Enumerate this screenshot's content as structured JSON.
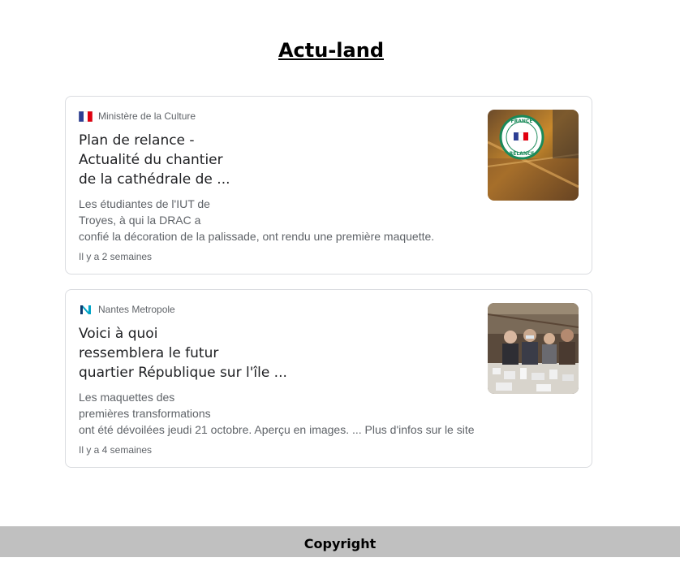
{
  "site": {
    "title": "Actu-land"
  },
  "articles": [
    {
      "source": "Ministère de la Culture",
      "source_logo": "french-flag-icon",
      "headline_lines": [
        "Plan de relance -",
        "Actualité du chantier",
        "de la cathédrale de ..."
      ],
      "snippet_lines": [
        "Les étudiantes de l'IUT de",
        "Troyes, à qui la DRAC a",
        "confié la décoration de la palissade, ont rendu une première maquette."
      ],
      "time": "Il y a 2 semaines",
      "thumbnail": "france-relance-badge-image"
    },
    {
      "source": "Nantes Metropole",
      "source_logo": "nantes-metropole-n-icon",
      "headline_lines": [
        "Voici à quoi",
        "ressemblera le futur",
        "quartier République sur l'île ..."
      ],
      "snippet_lines": [
        "Les maquettes des",
        "premières transformations",
        "ont été dévoilées jeudi 21 octobre. Aperçu en images. ... Plus d'infos sur le site"
      ],
      "time": "Il y a 4 semaines",
      "thumbnail": "architecture-model-people-image"
    }
  ],
  "footer": {
    "text": "Copyright"
  },
  "colors": {
    "footer_bg": "#c0c0c0",
    "border": "#dadce0",
    "muted_text": "#5f6368",
    "nantes_teal": "#00a4c7"
  }
}
